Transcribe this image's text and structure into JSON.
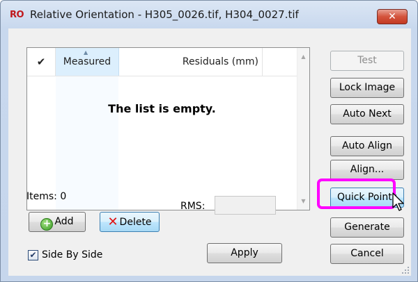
{
  "window": {
    "icon_text": "RO",
    "title": "Relative Orientation - H305_0026.tif, H304_0027.tif",
    "close_label": "✕"
  },
  "list": {
    "columns": [
      "✔",
      "Measured",
      "Residuals (mm)"
    ],
    "empty_message": "The list is empty."
  },
  "items_label": "Items: 0",
  "rms_label": "RMS:",
  "rms_value": "",
  "buttons": {
    "add": "Add",
    "delete": "Delete",
    "apply": "Apply",
    "test": "Test",
    "lock_image": "Lock Image",
    "auto_next": "Auto Next",
    "auto_align": "Auto Align",
    "align": "Align...",
    "quick_points": "Quick Points",
    "generate": "Generate",
    "cancel": "Cancel"
  },
  "side_by_side": {
    "label": "Side By Side",
    "checked": true
  },
  "colors": {
    "highlight": "#ff00ff",
    "close_button": "#c9432e"
  }
}
